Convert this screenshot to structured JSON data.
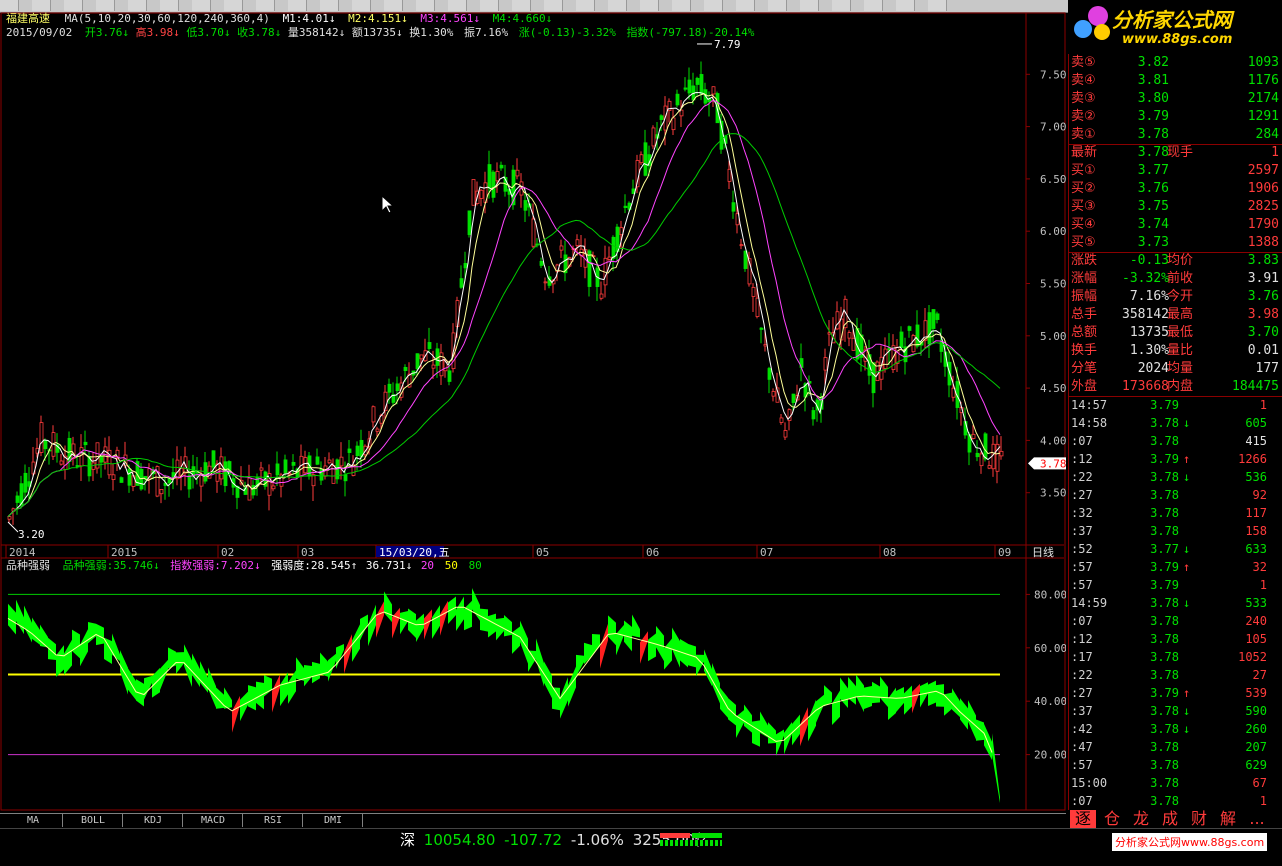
{
  "window": {
    "stock_name": "福建高速",
    "date": "2015/09/02"
  },
  "ma_header": {
    "ma_label": "MA(5,10,20,30,60,120,240,360,4)",
    "m1": "M1:4.01↓",
    "m2": "M2:4.151↓",
    "m3": "M3:4.561↓",
    "m4": "M4:4.660↓"
  },
  "ohlc_header": {
    "open": "开3.76↓",
    "high": "高3.98↓",
    "low": "低3.70↓",
    "close": "收3.78↓",
    "volume": "量358142↓",
    "amount": "额13735↓",
    "turnover": "换1.30%",
    "amplitude": "振7.16%",
    "change": "涨(-0.13)-3.32%",
    "index": "指数(-797.18)-20.14%"
  },
  "price_axis": [
    "7.50",
    "7.00",
    "6.50",
    "6.00",
    "5.50",
    "5.00",
    "4.50",
    "4.00",
    "3.50"
  ],
  "price_markers": {
    "high_label": "7.79",
    "low_label": "3.20",
    "current": "3.78"
  },
  "date_axis": [
    "2014",
    "2015",
    "02",
    "03",
    "15/03/20,五",
    "05",
    "06",
    "07",
    "08",
    "09"
  ],
  "period_label": "日线",
  "indicator_header": {
    "name": "品种强弱",
    "v1": "品种强弱:35.746↓",
    "v2": "指数强弱:7.202↓",
    "v3": "强弱度:28.545↑",
    "v4": "36.731↓",
    "l1": "20",
    "l2": "50",
    "l3": "80"
  },
  "indicator_axis": [
    "80.00",
    "60.00",
    "40.00",
    "20.00"
  ],
  "tabs": [
    "MA",
    "BOLL",
    "KDJ",
    "MACD",
    "RSI",
    "DMI"
  ],
  "logo": {
    "title": "分析家公式网",
    "url": "www.88gs.com"
  },
  "orderbook": {
    "sell": [
      {
        "label": "卖⑤",
        "price": "3.82",
        "vol": "1093"
      },
      {
        "label": "卖④",
        "price": "3.81",
        "vol": "1176"
      },
      {
        "label": "卖③",
        "price": "3.80",
        "vol": "2174"
      },
      {
        "label": "卖②",
        "price": "3.79",
        "vol": "1291"
      },
      {
        "label": "卖①",
        "price": "3.78",
        "vol": "284"
      }
    ],
    "latest": {
      "label": "最新",
      "price": "3.78",
      "label2": "现手",
      "vol": "1"
    },
    "buy": [
      {
        "label": "买①",
        "price": "3.77",
        "vol": "2597"
      },
      {
        "label": "买②",
        "price": "3.76",
        "vol": "1906"
      },
      {
        "label": "买③",
        "price": "3.75",
        "vol": "2825"
      },
      {
        "label": "买④",
        "price": "3.74",
        "vol": "1790"
      },
      {
        "label": "买⑤",
        "price": "3.73",
        "vol": "1388"
      }
    ]
  },
  "stats": [
    {
      "k1": "涨跌",
      "v1": "-0.13",
      "k2": "均价",
      "v2": "3.83",
      "c1": "grn",
      "c2": "grn"
    },
    {
      "k1": "涨幅",
      "v1": "-3.32%",
      "k2": "前收",
      "v2": "3.91",
      "c1": "grn",
      "c2": "wht"
    },
    {
      "k1": "振幅",
      "v1": "7.16%",
      "k2": "今开",
      "v2": "3.76",
      "c1": "wht",
      "c2": "grn"
    },
    {
      "k1": "总手",
      "v1": "358142",
      "k2": "最高",
      "v2": "3.98",
      "c1": "wht",
      "c2": "red"
    },
    {
      "k1": "总额",
      "v1": "13735",
      "k2": "最低",
      "v2": "3.70",
      "c1": "wht",
      "c2": "grn"
    },
    {
      "k1": "换手",
      "v1": "1.30%",
      "k2": "量比",
      "v2": "0.01",
      "c1": "wht",
      "c2": "wht"
    },
    {
      "k1": "分笔",
      "v1": "2024",
      "k2": "均量",
      "v2": "177",
      "c1": "wht",
      "c2": "wht"
    },
    {
      "k1": "外盘",
      "v1": "173668",
      "k2": "内盘",
      "v2": "184475",
      "c1": "red",
      "c2": "grn"
    }
  ],
  "ticks": [
    {
      "t": "14:57",
      "p": "3.79",
      "a": "",
      "v": "1",
      "pc": "grn",
      "vc": "red"
    },
    {
      "t": "14:58",
      "p": "3.78",
      "a": "↓",
      "v": "605",
      "pc": "grn",
      "vc": "grn"
    },
    {
      "t": ":07",
      "p": "3.78",
      "a": "",
      "v": "415",
      "pc": "grn",
      "vc": "wht"
    },
    {
      "t": ":12",
      "p": "3.79",
      "a": "↑",
      "v": "1266",
      "pc": "grn",
      "vc": "red"
    },
    {
      "t": ":22",
      "p": "3.78",
      "a": "↓",
      "v": "536",
      "pc": "grn",
      "vc": "grn"
    },
    {
      "t": ":27",
      "p": "3.78",
      "a": "",
      "v": "92",
      "pc": "grn",
      "vc": "red"
    },
    {
      "t": ":32",
      "p": "3.78",
      "a": "",
      "v": "117",
      "pc": "grn",
      "vc": "red"
    },
    {
      "t": ":37",
      "p": "3.78",
      "a": "",
      "v": "158",
      "pc": "grn",
      "vc": "red"
    },
    {
      "t": ":52",
      "p": "3.77",
      "a": "↓",
      "v": "633",
      "pc": "grn",
      "vc": "grn"
    },
    {
      "t": ":57",
      "p": "3.79",
      "a": "↑",
      "v": "32",
      "pc": "grn",
      "vc": "red"
    },
    {
      "t": ":57",
      "p": "3.79",
      "a": "",
      "v": "1",
      "pc": "grn",
      "vc": "red"
    },
    {
      "t": "14:59",
      "p": "3.78",
      "a": "↓",
      "v": "533",
      "pc": "grn",
      "vc": "grn"
    },
    {
      "t": ":07",
      "p": "3.78",
      "a": "",
      "v": "240",
      "pc": "grn",
      "vc": "red"
    },
    {
      "t": ":12",
      "p": "3.78",
      "a": "",
      "v": "105",
      "pc": "grn",
      "vc": "red"
    },
    {
      "t": ":17",
      "p": "3.78",
      "a": "",
      "v": "1052",
      "pc": "grn",
      "vc": "red"
    },
    {
      "t": ":22",
      "p": "3.78",
      "a": "",
      "v": "27",
      "pc": "grn",
      "vc": "red"
    },
    {
      "t": ":27",
      "p": "3.79",
      "a": "↑",
      "v": "539",
      "pc": "grn",
      "vc": "red"
    },
    {
      "t": ":37",
      "p": "3.78",
      "a": "↓",
      "v": "590",
      "pc": "grn",
      "vc": "grn"
    },
    {
      "t": ":42",
      "p": "3.78",
      "a": "↓",
      "v": "260",
      "pc": "grn",
      "vc": "grn"
    },
    {
      "t": ":47",
      "p": "3.78",
      "a": "",
      "v": "207",
      "pc": "grn",
      "vc": "grn"
    },
    {
      "t": ":57",
      "p": "3.78",
      "a": "",
      "v": "629",
      "pc": "grn",
      "vc": "grn"
    },
    {
      "t": "15:00",
      "p": "3.78",
      "a": "",
      "v": "67",
      "pc": "grn",
      "vc": "red"
    },
    {
      "t": ":07",
      "p": "3.78",
      "a": "",
      "v": "1",
      "pc": "grn",
      "vc": "red"
    }
  ],
  "quote_tabs": [
    "逐",
    "仓",
    "龙",
    "成",
    "财",
    "解",
    "..."
  ],
  "status": {
    "market": "深",
    "index_value": "10054.80",
    "index_change": "-107.72",
    "index_pct": "-1.06%",
    "amount": "3255.00亿",
    "watermark": "分析家公式网www.88gs.com"
  },
  "colors": {
    "up": "#ff3b3b",
    "down": "#00e000",
    "ma1": "#ffffff",
    "ma2": "#ffff99",
    "ma3": "#ff44ff",
    "ma4": "#00cc00",
    "grid": "#8b0000"
  }
}
